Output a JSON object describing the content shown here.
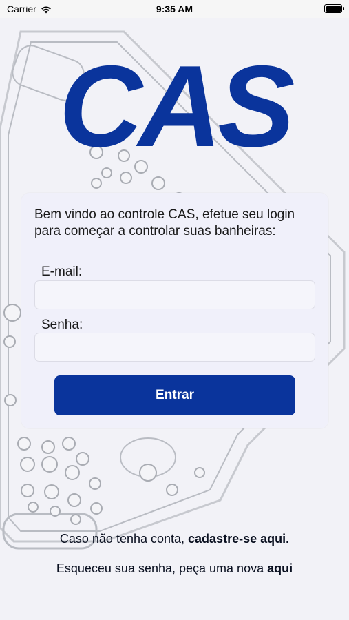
{
  "status_bar": {
    "carrier": "Carrier",
    "time": "9:35 AM"
  },
  "brand": {
    "logo_text": "CAS",
    "color": "#0a349c"
  },
  "login": {
    "welcome_text": "Bem vindo ao controle CAS, efetue seu login para começar a controlar suas banheiras:",
    "email_label": "E-mail:",
    "email_value": "",
    "password_label": "Senha:",
    "password_value": "",
    "submit_label": "Entrar"
  },
  "footer": {
    "signup_prefix": "Caso não tenha conta, ",
    "signup_link": "cadastre-se aqui.",
    "forgot_prefix": "Esqueceu sua senha, peça uma nova ",
    "forgot_link": "aqui"
  }
}
